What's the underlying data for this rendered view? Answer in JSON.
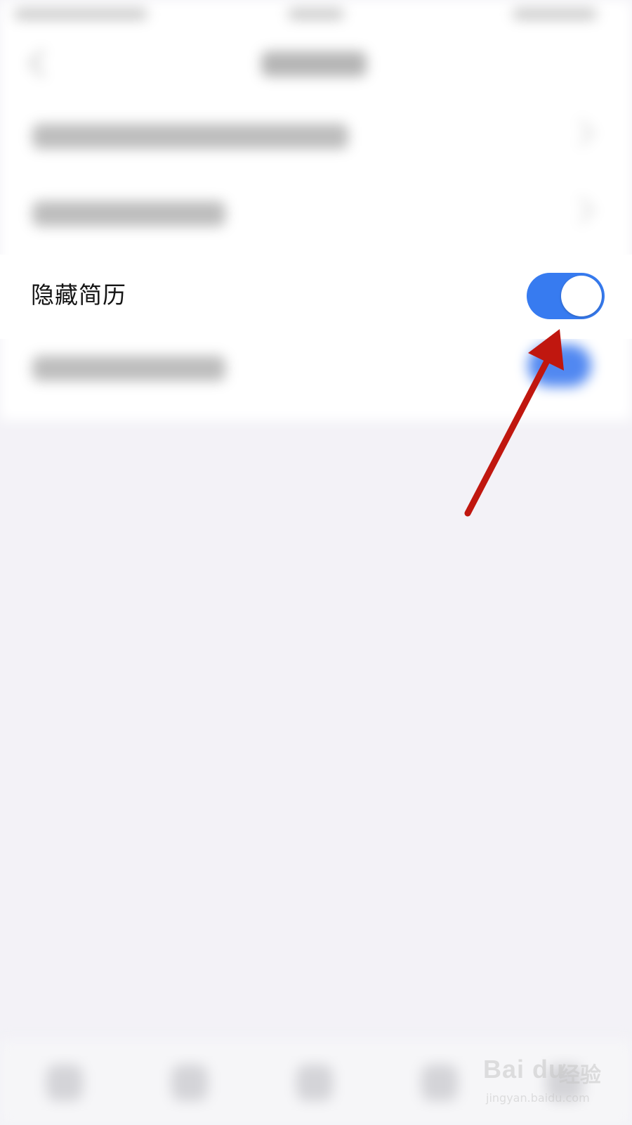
{
  "settings": {
    "hide_resume": {
      "label": "隐藏简历",
      "enabled": true
    }
  },
  "colors": {
    "toggle_on": "#377bf0",
    "annotation_arrow": "#c0170f",
    "background": "#f3f2f7"
  },
  "icons": {
    "back": "chevron-left-icon",
    "row_arrow": "chevron-right-icon"
  },
  "watermark": {
    "logo": "Bai du",
    "name": "经验",
    "url": "jingyan.baidu.com"
  }
}
